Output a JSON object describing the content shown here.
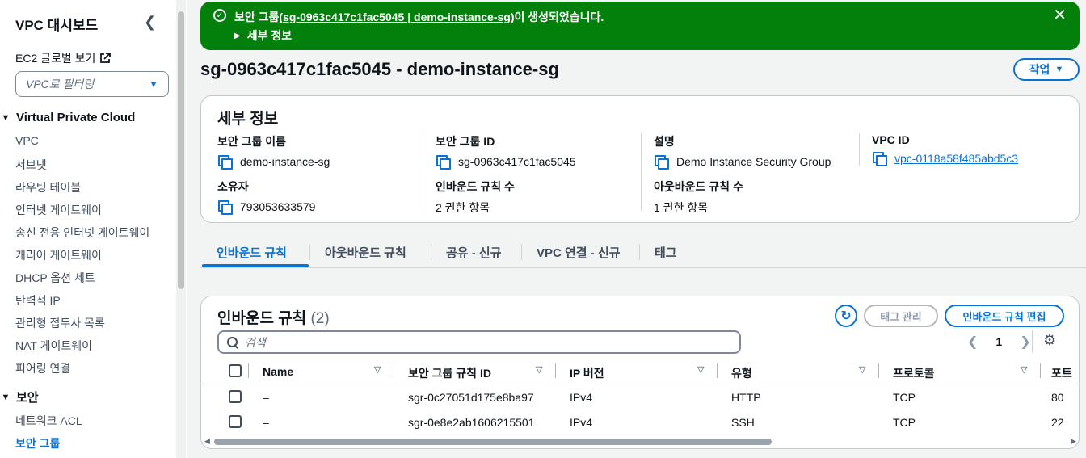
{
  "sidebar": {
    "title": "VPC 대시보드",
    "ec2_link": "EC2 글로벌 보기",
    "filter_placeholder": "VPC로 필터링",
    "section_vpc": "Virtual Private Cloud",
    "vpc_items": [
      {
        "label": "VPC"
      },
      {
        "label": "서브넷"
      },
      {
        "label": "라우팅 테이블"
      },
      {
        "label": "인터넷 게이트웨이"
      },
      {
        "label": "송신 전용 인터넷 게이트웨이"
      },
      {
        "label": "캐리어 게이트웨이"
      },
      {
        "label": "DHCP 옵션 세트"
      },
      {
        "label": "탄력적 IP"
      },
      {
        "label": "관리형 접두사 목록"
      },
      {
        "label": "NAT 게이트웨이"
      },
      {
        "label": "피어링 연결"
      }
    ],
    "section_security": "보안",
    "security_items": [
      {
        "label": "네트워크 ACL"
      },
      {
        "label": "보안 그룹",
        "active": true
      }
    ]
  },
  "flash": {
    "prefix": "보안 그룹(",
    "link": "sg-0963c417c1fac5045 | demo-instance-sg",
    "suffix": ")이 생성되었습니다.",
    "details": "세부 정보",
    "color": "#037f0c"
  },
  "page": {
    "title": "sg-0963c417c1fac5045 - demo-instance-sg",
    "actions_label": "작업"
  },
  "details": {
    "title": "세부 정보",
    "fields": [
      {
        "key": "보안 그룹 이름",
        "value": "demo-instance-sg",
        "copy": true
      },
      {
        "key": "보안 그룹 ID",
        "value": "sg-0963c417c1fac5045",
        "copy": true
      },
      {
        "key": "설명",
        "value": "Demo Instance Security Group",
        "copy": true
      },
      {
        "key": "VPC ID",
        "value": "vpc-0118a58f485abd5c3",
        "copy": true,
        "link": true
      },
      {
        "key": "소유자",
        "value": "793053633579",
        "copy": true
      },
      {
        "key": "인바운드 규칙 수",
        "value": "2 권한 항목"
      },
      {
        "key": "아웃바운드 규칙 수",
        "value": "1 권한 항목"
      }
    ]
  },
  "tabs": [
    {
      "label": "인바운드 규칙",
      "active": true
    },
    {
      "label": "아웃바운드 규칙"
    },
    {
      "label": "공유 - 신규"
    },
    {
      "label": "VPC 연결 - 신규"
    },
    {
      "label": "태그"
    }
  ],
  "inbound": {
    "title": "인바운드 규칙",
    "count": "(2)",
    "tag_btn": "태그 관리",
    "edit_btn": "인바운드 규칙 편집",
    "search_placeholder": "검색",
    "page": "1",
    "columns": [
      "Name",
      "보안 그룹 규칙 ID",
      "IP 버전",
      "유형",
      "프로토콜",
      "포트"
    ],
    "rows": [
      {
        "name": "–",
        "rule_id": "sgr-0c27051d175e8ba97",
        "ip": "IPv4",
        "type": "HTTP",
        "protocol": "TCP",
        "port": "80"
      },
      {
        "name": "–",
        "rule_id": "sgr-0e8e2ab1606215501",
        "ip": "IPv4",
        "type": "SSH",
        "protocol": "TCP",
        "port": "22"
      }
    ]
  },
  "colors": {
    "accent": "#0972d3",
    "success": "#037f0c",
    "text": "#0f141a"
  }
}
